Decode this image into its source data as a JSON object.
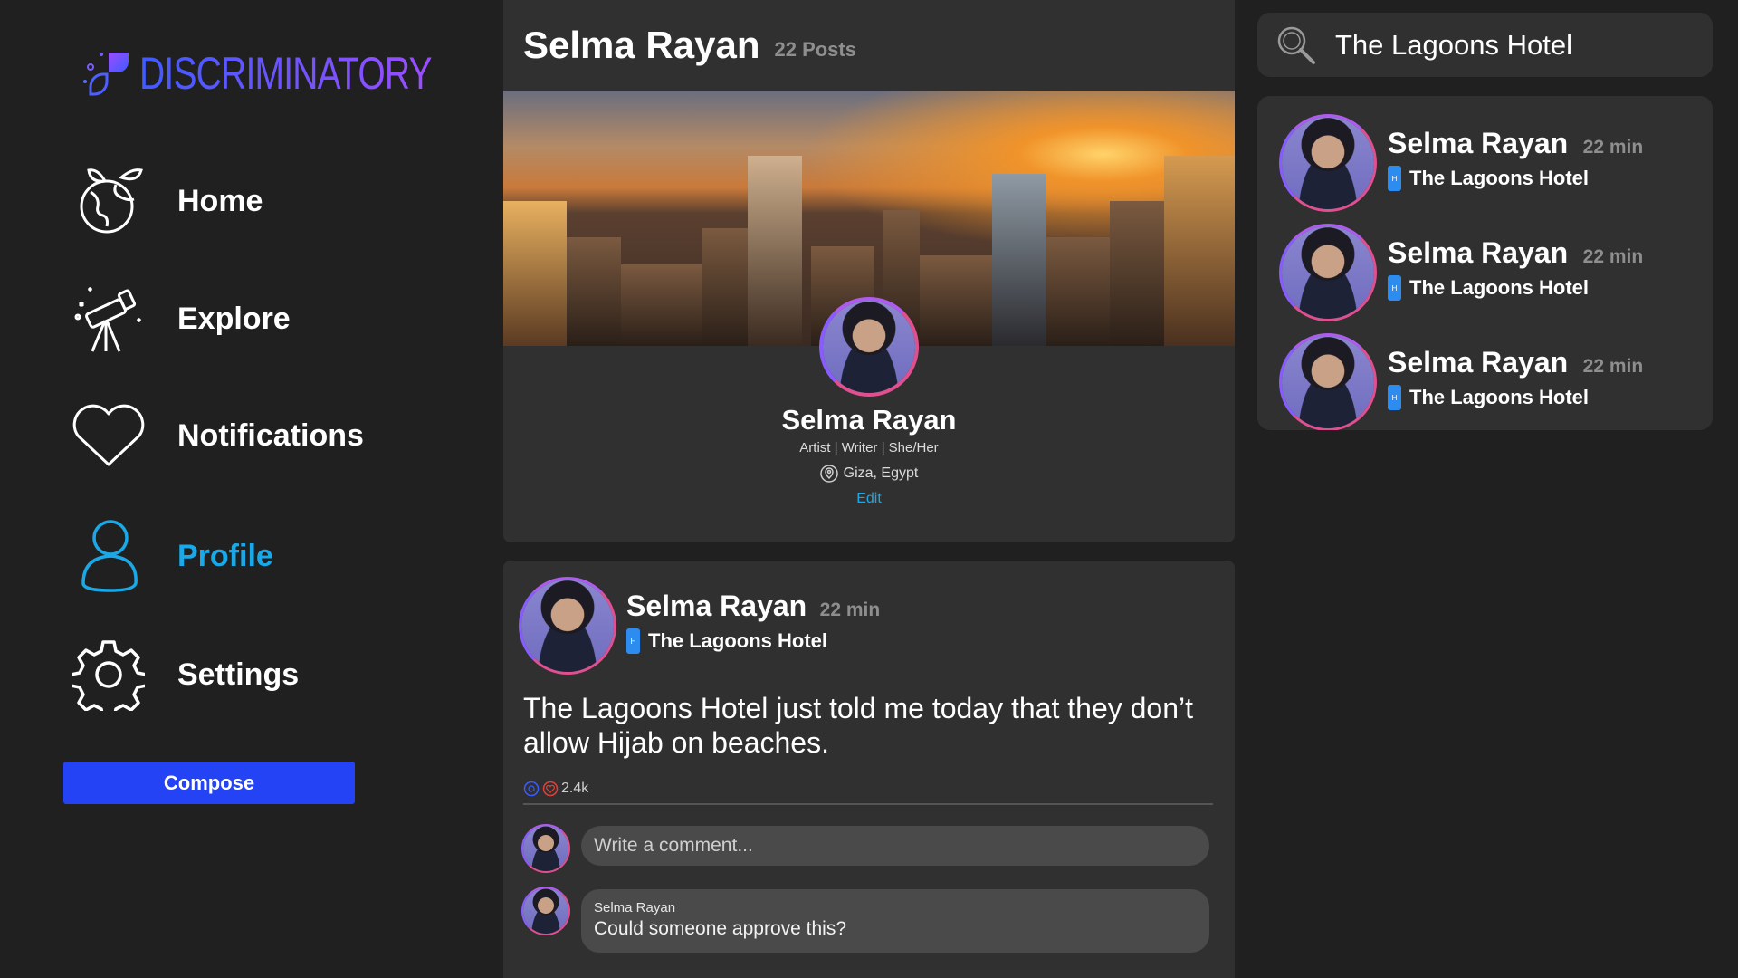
{
  "app": {
    "logo_text": "DISCRIMINATORY"
  },
  "nav": {
    "items": [
      {
        "label": "Home",
        "icon": "globe-plant-icon"
      },
      {
        "label": "Explore",
        "icon": "telescope-icon"
      },
      {
        "label": "Notifications",
        "icon": "heart-icon"
      },
      {
        "label": "Profile",
        "icon": "user-icon",
        "active": true
      },
      {
        "label": "Settings",
        "icon": "gear-icon"
      }
    ],
    "compose_label": "Compose"
  },
  "colors": {
    "accent": "#1aa9e8",
    "compose": "#2343f5",
    "background": "#202020",
    "card": "#303030"
  },
  "profile": {
    "header_name": "Selma Rayan",
    "posts_count": "22 Posts",
    "name": "Selma Rayan",
    "bio": "Artist | Writer | She/Her",
    "location": "Giza, Egypt",
    "edit_label": "Edit"
  },
  "post": {
    "author": "Selma Rayan",
    "time": "22 min",
    "place": "The Lagoons Hotel",
    "text": "The Lagoons Hotel just told me today that they don’t allow Hijab on beaches.",
    "reactions_count": "2.4k",
    "comment_placeholder": "Write a comment...",
    "comments": [
      {
        "author": "Selma Rayan",
        "text": "Could someone approve this?"
      }
    ]
  },
  "search": {
    "value": "The Lagoons Hotel"
  },
  "results": [
    {
      "name": "Selma Rayan",
      "time": "22 min",
      "place": "The Lagoons Hotel"
    },
    {
      "name": "Selma Rayan",
      "time": "22 min",
      "place": "The Lagoons Hotel"
    },
    {
      "name": "Selma Rayan",
      "time": "22 min",
      "place": "The Lagoons Hotel"
    }
  ]
}
